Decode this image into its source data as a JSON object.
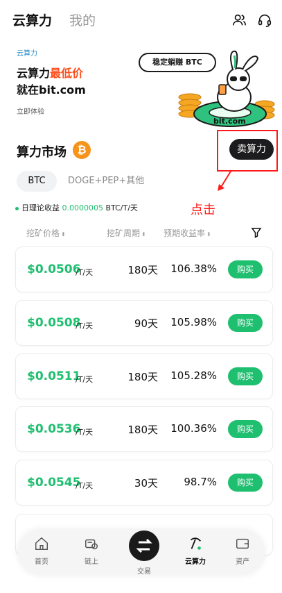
{
  "header": {
    "tabs": [
      {
        "label": "云算力",
        "active": true
      },
      {
        "label": "我的",
        "active": false
      }
    ],
    "icons": [
      "user-group-icon",
      "headset-icon"
    ]
  },
  "banner": {
    "tag": "云算力",
    "line1_prefix": "云算力",
    "line1_highlight": "最低价",
    "line2": "就在bit.com",
    "cta": "立即体验",
    "bubble": "稳定躺赚 BTC",
    "art_label": "bit.com"
  },
  "market": {
    "title": "算力市场",
    "coin_icon": "btc-icon",
    "sell_button": "卖算力",
    "annotation": "点击",
    "coin_tabs": [
      {
        "label": "BTC",
        "active": true
      },
      {
        "label": "DOGE+PEP+其他",
        "active": false
      }
    ],
    "yield_label": "日理论收益",
    "yield_value": "0.0000005",
    "yield_unit": "BTC/T/天"
  },
  "table": {
    "headers": [
      "挖矿价格",
      "挖矿周期",
      "预期收益率"
    ],
    "rows": [
      {
        "price": "$0.0506",
        "unit": "/T/天",
        "period": "180天",
        "rate": "106.38%",
        "action": "购买"
      },
      {
        "price": "$0.0508",
        "unit": "/T/天",
        "period": "90天",
        "rate": "105.98%",
        "action": "购买"
      },
      {
        "price": "$0.0511",
        "unit": "/T/天",
        "period": "180天",
        "rate": "105.28%",
        "action": "购买"
      },
      {
        "price": "$0.0536",
        "unit": "/T/天",
        "period": "180天",
        "rate": "100.36%",
        "action": "购买"
      },
      {
        "price": "$0.0545",
        "unit": "/T/天",
        "period": "30天",
        "rate": "98.7%",
        "action": "购买"
      }
    ]
  },
  "bottom_nav": {
    "items": [
      {
        "label": "首页",
        "icon": "home-icon"
      },
      {
        "label": "链上",
        "icon": "onchain-icon"
      },
      {
        "label": "交易",
        "icon": "swap-icon"
      },
      {
        "label": "云算力",
        "icon": "pickaxe-icon",
        "active": true
      },
      {
        "label": "资产",
        "icon": "wallet-icon"
      }
    ]
  },
  "colors": {
    "accent_green": "#1fbf70",
    "highlight_red": "#ff4d1c",
    "btc_orange": "#f6931a",
    "annotation_red": "#ff1a1a"
  }
}
